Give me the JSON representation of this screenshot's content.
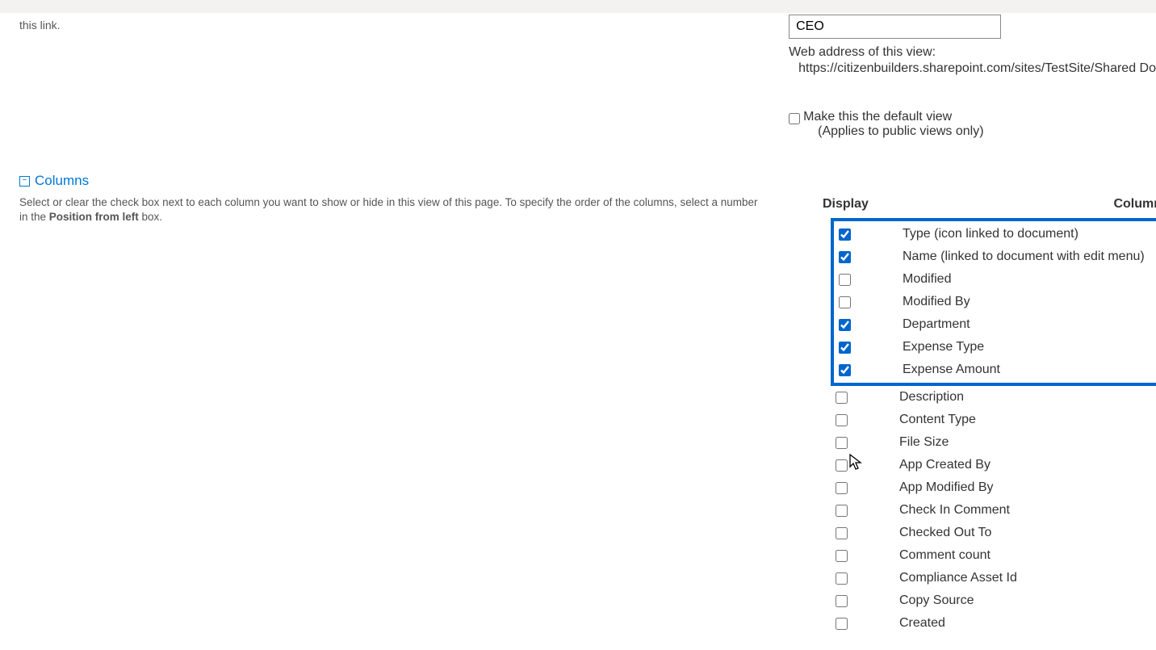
{
  "name_section": {
    "help_text": "this link.",
    "view_name_value": "CEO",
    "web_address_label": "Web address of this view:",
    "web_address_url": "https://citizenbuilders.sharepoint.com/sites/TestSite/Shared Do",
    "default_view_label": "Make this the default view",
    "default_view_sub": "(Applies to public views only)",
    "default_view_checked": false
  },
  "columns_section": {
    "title": "Columns",
    "help_a": "Select or clear the check box next to each column you want to show or hide in this view of this page. To specify the order of the columns, select a number in the ",
    "help_bold": "Position from left",
    "help_b": " box."
  },
  "columns_table": {
    "header_display": "Display",
    "header_column": "Column",
    "highlighted": [
      {
        "label": "Type (icon linked to document)",
        "checked": true
      },
      {
        "label": "Name (linked to document with edit menu)",
        "checked": true
      },
      {
        "label": "Modified",
        "checked": false
      },
      {
        "label": "Modified By",
        "checked": false
      },
      {
        "label": "Department",
        "checked": true
      },
      {
        "label": "Expense Type",
        "checked": true
      },
      {
        "label": "Expense Amount",
        "checked": true
      }
    ],
    "rest": [
      {
        "label": "Description",
        "checked": false
      },
      {
        "label": "Content Type",
        "checked": false
      },
      {
        "label": "File Size",
        "checked": false
      },
      {
        "label": "App Created By",
        "checked": false
      },
      {
        "label": "App Modified By",
        "checked": false
      },
      {
        "label": "Check In Comment",
        "checked": false
      },
      {
        "label": "Checked Out To",
        "checked": false
      },
      {
        "label": "Comment count",
        "checked": false
      },
      {
        "label": "Compliance Asset Id",
        "checked": false
      },
      {
        "label": "Copy Source",
        "checked": false
      },
      {
        "label": "Created",
        "checked": false
      }
    ]
  }
}
